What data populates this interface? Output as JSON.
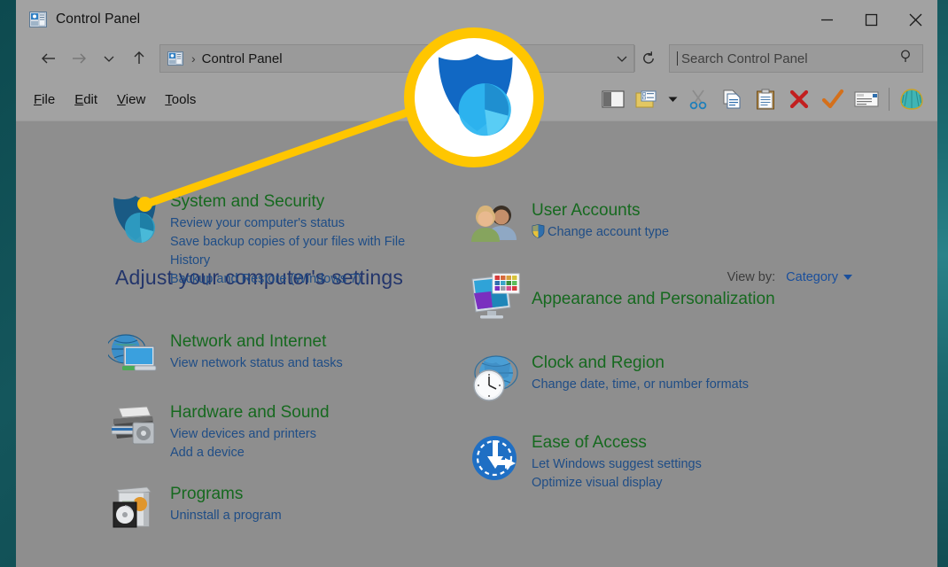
{
  "window": {
    "title": "Control Panel",
    "title_icon": "control-panel-icon",
    "controls": {
      "minimize": "minimize-icon",
      "maximize": "maximize-icon",
      "close": "close-icon"
    }
  },
  "addressbar": {
    "back": "back-arrow-icon",
    "forward": "forward-arrow-icon",
    "recent": "chevron-down-icon",
    "up": "up-arrow-icon",
    "path_icon": "control-panel-icon",
    "separator": "›",
    "crumb": "Control Panel",
    "dropdown": "chevron-down-icon",
    "refresh": "refresh-icon"
  },
  "search": {
    "placeholder": "Search Control Panel",
    "icon": "search-icon"
  },
  "menu": {
    "items": [
      {
        "label": "File",
        "accel": "F",
        "rest": "ile"
      },
      {
        "label": "Edit",
        "accel": "E",
        "rest": "dit"
      },
      {
        "label": "View",
        "accel": "V",
        "rest": "iew"
      },
      {
        "label": "Tools",
        "accel": "T",
        "rest": "ools"
      }
    ]
  },
  "toolbar": {
    "items": [
      {
        "name": "preview-pane-icon",
        "label": "Preview pane"
      },
      {
        "name": "properties-icon",
        "label": "Properties"
      },
      {
        "name": "properties-dropdown-icon",
        "label": "Properties menu"
      },
      {
        "name": "cut-scissors-icon",
        "label": "Cut"
      },
      {
        "name": "copy-icon",
        "label": "Copy"
      },
      {
        "name": "paste-clipboard-icon",
        "label": "Paste"
      },
      {
        "name": "delete-x-icon",
        "label": "Delete"
      },
      {
        "name": "checkmark-icon",
        "label": "Accept"
      },
      {
        "name": "mail-envelope-icon",
        "label": "Send mail"
      },
      {
        "name": "shell-icon",
        "label": "Shell"
      }
    ]
  },
  "content": {
    "heading": "Adjust your computer's settings",
    "viewby": {
      "label": "View by:",
      "value": "Category",
      "caret": "chevron-down-icon"
    },
    "left_column": [
      {
        "icon": "shield-security-icon",
        "title": "System and Security",
        "links": [
          "Review your computer's status",
          "Save backup copies of your files with File History",
          "Backup and Restore (Windows 7)"
        ]
      },
      {
        "icon": "network-globe-monitor-icon",
        "title": "Network and Internet",
        "links": [
          "View network status and tasks"
        ]
      },
      {
        "icon": "printer-icon",
        "title": "Hardware and Sound",
        "links": [
          "View devices and printers",
          "Add a device"
        ]
      },
      {
        "icon": "software-box-cd-icon",
        "title": "Programs",
        "links": [
          "Uninstall a program"
        ]
      }
    ],
    "right_column": [
      {
        "icon": "user-accounts-people-icon",
        "title": "User Accounts",
        "links": [
          "Change account type"
        ],
        "link_badge": "uac-shield-icon"
      },
      {
        "icon": "appearance-monitor-icon",
        "title": "Appearance and Personalization",
        "links": []
      },
      {
        "icon": "clock-globe-icon",
        "title": "Clock and Region",
        "links": [
          "Change date, time, or number formats"
        ]
      },
      {
        "icon": "ease-of-access-icon",
        "title": "Ease of Access",
        "links": [
          "Let Windows suggest settings",
          "Optimize visual display"
        ]
      }
    ]
  },
  "callout": {
    "highlight_icon": "shield-security-icon",
    "target": "system-and-security-icon"
  },
  "colors": {
    "desktop": "#124d53",
    "window_chrome": "#a2a2a2",
    "content_bg": "#8e8e8e",
    "heading_blue": "#23356b",
    "category_green": "#16691f",
    "link_blue": "#1f4d86",
    "callout_yellow": "#ffc600",
    "accent_blue": "#1a4f9c"
  }
}
